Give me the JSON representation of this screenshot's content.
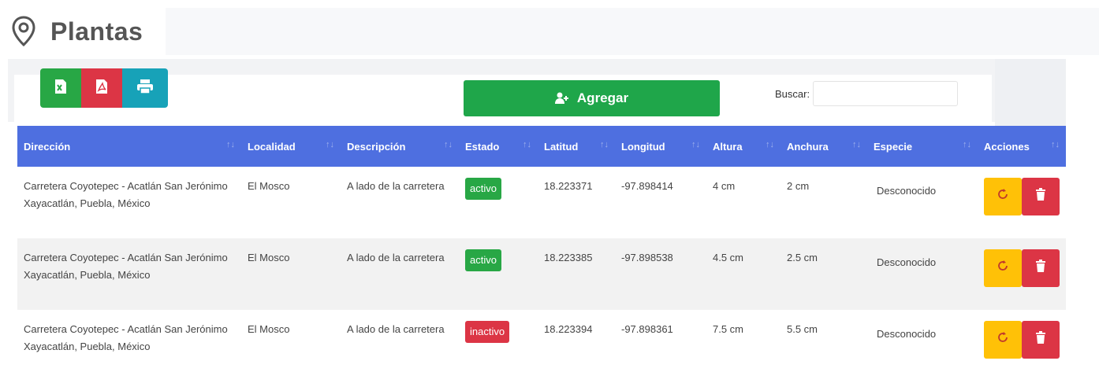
{
  "page": {
    "title": "Plantas",
    "title_icon": "map-pin-icon"
  },
  "toolbar": {
    "export_buttons": [
      {
        "name": "excel-export-button",
        "icon": "file-excel-icon",
        "color": "#28a745"
      },
      {
        "name": "pdf-export-button",
        "icon": "file-pdf-icon",
        "color": "#dc3545"
      },
      {
        "name": "print-button",
        "icon": "print-icon",
        "color": "#17a2b8"
      }
    ],
    "add_label": "Agregar",
    "add_icon": "user-plus-icon",
    "search_label": "Buscar:",
    "search_value": ""
  },
  "table": {
    "header_color": "#4e6fe0",
    "columns": [
      "Dirección",
      "Localidad",
      "Descripción",
      "Estado",
      "Latitud",
      "Longitud",
      "Altura",
      "Anchura",
      "Especie",
      "Acciones"
    ],
    "rows": [
      {
        "direccion": "Carretera Coyotepec - Acatlán San Jerónimo Xayacatlán, Puebla, México",
        "localidad": "El Mosco",
        "descripcion": "A lado de la carretera",
        "estado": "activo",
        "latitud": "18.223371",
        "longitud": "-97.898414",
        "altura": "4 cm",
        "anchura": "2 cm",
        "especie": "Desconocido"
      },
      {
        "direccion": "Carretera Coyotepec - Acatlán San Jerónimo Xayacatlán, Puebla, México",
        "localidad": "El Mosco",
        "descripcion": "A lado de la carretera",
        "estado": "activo",
        "latitud": "18.223385",
        "longitud": "-97.898538",
        "altura": "4.5 cm",
        "anchura": "2.5 cm",
        "especie": "Desconocido"
      },
      {
        "direccion": "Carretera Coyotepec - Acatlán San Jerónimo Xayacatlán, Puebla, México",
        "localidad": "El Mosco",
        "descripcion": "A lado de la carretera",
        "estado": "inactivo",
        "latitud": "18.223394",
        "longitud": "-97.898361",
        "altura": "7.5 cm",
        "anchura": "5.5 cm",
        "especie": "Desconocido"
      }
    ],
    "action_icons": [
      "refresh-icon",
      "trash-icon"
    ],
    "status_colors": {
      "activo": "#28a745",
      "inactivo": "#dc3545"
    }
  }
}
